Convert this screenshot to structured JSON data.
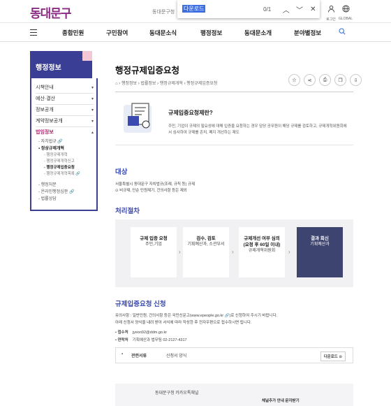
{
  "header": {
    "logo": "동대문구",
    "site_label": "동대문구청",
    "login_label": "로그인",
    "global_label": "GLOBAL"
  },
  "findbar": {
    "query": "다운로드",
    "count": "0/1"
  },
  "nav": {
    "items": [
      "종합민원",
      "구민참여",
      "동대문소식",
      "행정정보",
      "동대문소개",
      "분야별정보"
    ]
  },
  "sidebar": {
    "title": "행정정보",
    "menus": [
      {
        "label": "시책안내",
        "arrow": "▾"
      },
      {
        "label": "예산·결산",
        "arrow": "▾"
      },
      {
        "label": "정보공개",
        "arrow": "▾"
      },
      {
        "label": "계약정보공개",
        "arrow": "▾"
      },
      {
        "label": "법임정보",
        "arrow": "▴"
      }
    ],
    "sub": [
      {
        "label": "- 자치법규 🔗",
        "bold": false,
        "level": 1
      },
      {
        "label": "▪ 정상규제개혁",
        "bold": true,
        "level": 1
      },
      {
        "label": "- 행정규제개혁",
        "bold": false,
        "level": 2
      },
      {
        "label": "- 행정규제개혁신고",
        "bold": false,
        "level": 2
      },
      {
        "label": "- 행정규제입증요청",
        "bold": true,
        "level": 2
      },
      {
        "label": "- 행정규제개혁목록 🔗",
        "bold": false,
        "level": 2
      },
      {
        "label": "- 행정처분",
        "bold": false,
        "level": 1
      },
      {
        "label": "- 온라인행정심판 🔗",
        "bold": false,
        "level": 1
      },
      {
        "label": "- 법률상담",
        "bold": false,
        "level": 1
      }
    ]
  },
  "page": {
    "title": "행정규제입증요청",
    "breadcrumb": "⌂ › 행정정보 › 법률정보 › 행정규제개혁 › 행정규제입증요청",
    "intro": {
      "heading": "규제입증요청제란?",
      "desc": "주민, 기업이 규제의 필요성에 대해 입증을 요청하는 경우 담당 공무원이 해당 규제를 검토하고, 규제개혁위원회에서 심사하여 규제를 존치, 폐지 개선하는 제도"
    },
    "target": {
      "heading": "대상",
      "line1": "서울특별시 동대문구 자치법규(조례, 규칙 등) 규제",
      "line2": "⊙ 비규제, 단순 민원제기, 건의사항 등은 제외"
    },
    "process": {
      "heading": "처리절차",
      "steps": [
        {
          "title": "규제 입증 요청",
          "sub": "주민,기업"
        },
        {
          "title": "검수, 검토",
          "sub": "기획예산과, 소관부서"
        },
        {
          "title": "규제개선 여부 심의",
          "sub2": "(요청 후 60일 이내)",
          "sub": "규제개혁위원회"
        },
        {
          "title": "결과 회신",
          "sub": "기획예산과"
        }
      ]
    },
    "request": {
      "heading": "규제입증요청 신청",
      "note1": "유의사항 : 일반민원, 건의사항 등은 국민신문고(www.epeople.go.kr 🔗)로 신청하여 주시기 바랍니다.",
      "note2": "아래 신청서 양식을 내려 받아 서식에 따라 작성한 후 전자우편으로 접수하시면 됩니다.",
      "email_label": "접수처",
      "email": "jyeon92@ddm.go.kr",
      "contact_label": "연락처",
      "contact": "기획예산과 법무팀 02-2127-4317"
    },
    "files": {
      "label": "관련서류",
      "file": "신청서 양식",
      "download": "다운로드 ⊙"
    }
  },
  "footer": {
    "left": "동대문구청 카카오톡채널",
    "right": "채널추가 안내 문자받기"
  }
}
